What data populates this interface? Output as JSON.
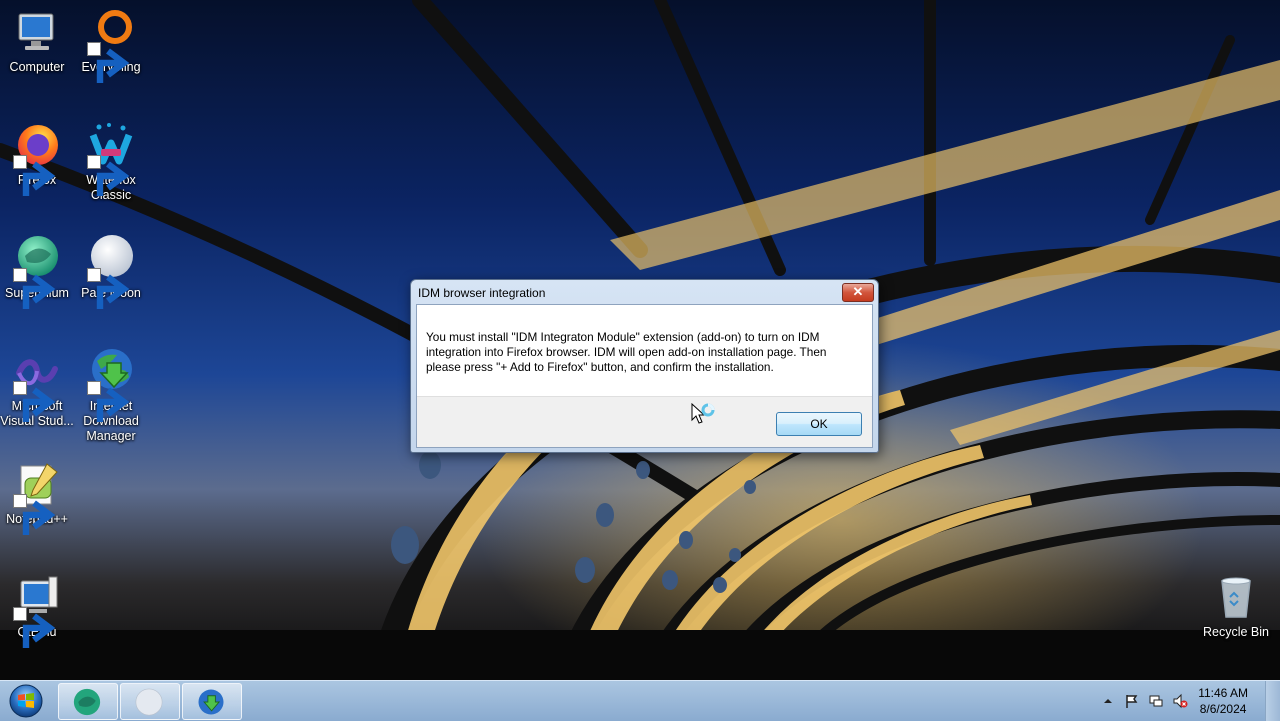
{
  "desktop": {
    "icons": [
      {
        "label": "Computer",
        "icon": "computer-icon"
      },
      {
        "label": "Everything",
        "icon": "everything-icon"
      },
      {
        "label": "Firefox",
        "icon": "firefox-icon"
      },
      {
        "label": "Waterfox Classic",
        "icon": "waterfox-icon"
      },
      {
        "label": "Supermium",
        "icon": "supermium-icon"
      },
      {
        "label": "Pale Moon",
        "icon": "pale-moon-icon"
      },
      {
        "label": "Microsoft Visual Stud...",
        "icon": "visual-studio-icon"
      },
      {
        "label": "Internet Download Manager",
        "icon": "idm-icon"
      },
      {
        "label": "Notepad++",
        "icon": "notepadpp-icon"
      },
      {
        "label": "QtEmu",
        "icon": "qtemu-icon"
      },
      {
        "label": "Recycle Bin",
        "icon": "recycle-bin-icon"
      }
    ]
  },
  "dialog": {
    "title": "IDM browser integration",
    "close_label": "✕",
    "message": "You must install \"IDM Integraton Module\" extension (add-on) to turn on IDM integration into Firefox browser. IDM will open add-on installation page. Then please press \"+ Add to Firefox\" button, and confirm the installation.",
    "ok_label": "OK"
  },
  "taskbar": {
    "start_icon": "windows-start-icon",
    "pinned": [
      {
        "icon": "supermium-icon"
      },
      {
        "icon": "pale-moon-icon"
      },
      {
        "icon": "idm-icon"
      }
    ],
    "tray_icons": [
      "chevron-up-icon",
      "action-center-flag-icon",
      "network-icon",
      "volume-muted-icon"
    ],
    "clock": {
      "time": "11:46 AM",
      "date": "8/6/2024"
    }
  },
  "colors": {
    "dialog_frame": "#c4d6ec",
    "close_button": "#c53b1f",
    "taskbar": "#86a8ce"
  }
}
